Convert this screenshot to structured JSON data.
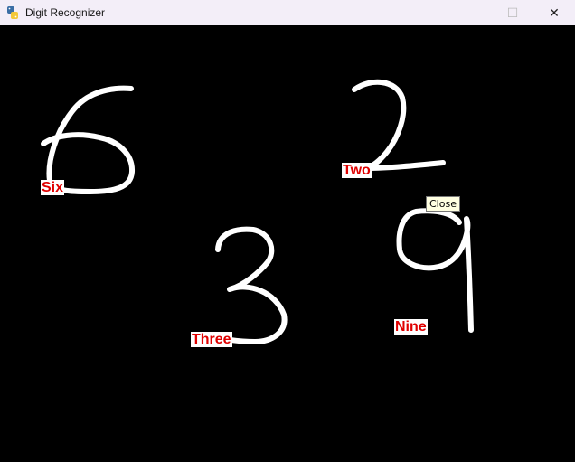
{
  "window": {
    "title": "Digit Recognizer",
    "app_icon": "python-icon",
    "controls": {
      "minimize": "—",
      "maximize": "☐",
      "close": "✕"
    }
  },
  "canvas": {
    "background": "#000000",
    "stroke_color": "#ffffff",
    "label_color": "#e00000",
    "label_background": "#ffffff",
    "predictions": [
      {
        "digit": "6",
        "label": "Six"
      },
      {
        "digit": "2",
        "label": "Two"
      },
      {
        "digit": "3",
        "label": "Three"
      },
      {
        "digit": "9",
        "label": "Nine"
      }
    ]
  },
  "tooltip": {
    "text": "Close"
  }
}
